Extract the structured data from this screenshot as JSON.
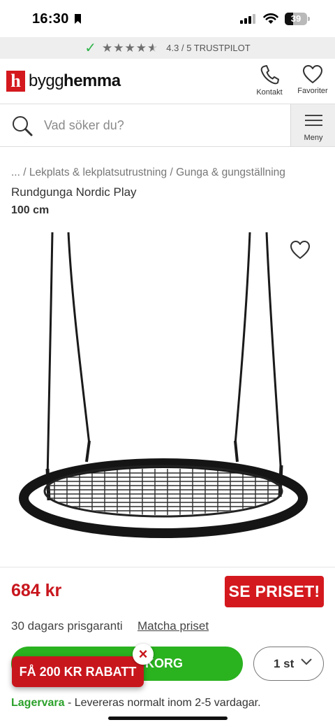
{
  "status_bar": {
    "time": "16:30",
    "battery": "39",
    "battery_level": 0.39
  },
  "trust": {
    "rating_text": "4.3 / 5 TRUSTPILOT",
    "stars": [
      "★",
      "★",
      "★",
      "★",
      "★"
    ],
    "rating": 4.3
  },
  "header": {
    "logo_mark": "h",
    "logo_text_light": "bygg",
    "logo_text_bold": "hemma",
    "contact_label": "Kontakt",
    "favorites_label": "Favoriter"
  },
  "search": {
    "placeholder": "Vad söker du?",
    "menu_label": "Meny"
  },
  "breadcrumb": {
    "ellipsis": "...",
    "separator": " / ",
    "items": [
      "Lekplats & lekplatsutrustning",
      "Gunga & gungställning"
    ]
  },
  "product": {
    "title": "Rundgunga Nordic Play",
    "variant": "100 cm"
  },
  "pricing": {
    "price": "684 kr",
    "see_price": "SE PRISET!",
    "guarantee": "30 dagars prisgaranti",
    "match_link": "Matcha priset"
  },
  "cart": {
    "button_label": "KORG",
    "quantity": "1 st"
  },
  "promo": {
    "label": "FÅ 200 KR RABATT",
    "close": "×"
  },
  "stock": {
    "status": "Lagervara",
    "delivery": " - Levereras normalt inom 2-5 vardagar."
  },
  "colors": {
    "brand_red": "#d4191e",
    "cart_green": "#2ab21f",
    "stock_green": "#2ba12a",
    "trust_check": "#2fb34a"
  },
  "icons": {
    "bookmark": "bookmark-icon",
    "signal": "signal-icon",
    "wifi": "wifi-icon",
    "battery": "battery-icon",
    "check": "check-icon",
    "star": "star-icon",
    "phone": "phone-icon",
    "heart": "heart-icon",
    "search": "search-icon",
    "menu": "hamburger-icon",
    "chevron": "chevron-down-icon",
    "close": "close-icon"
  }
}
